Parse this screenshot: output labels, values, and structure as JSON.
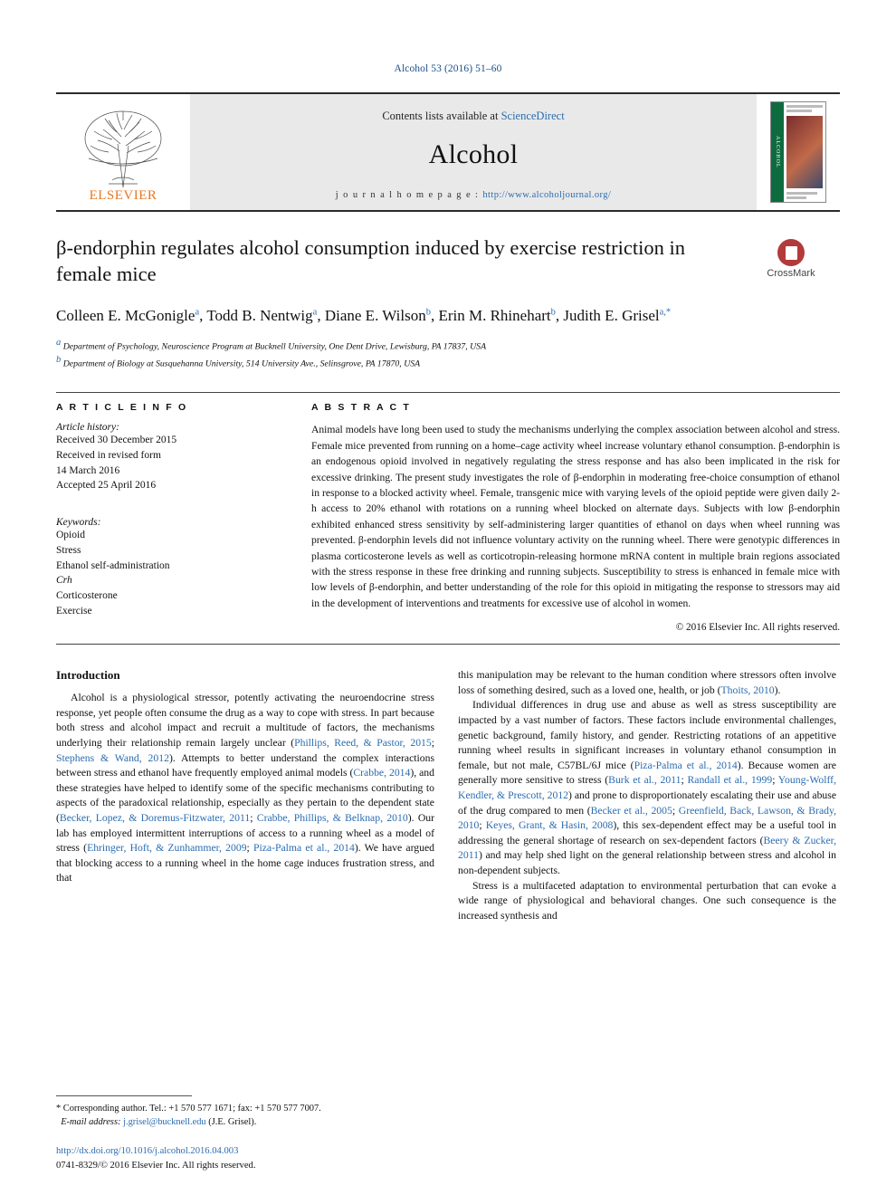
{
  "runhead": "Alcohol 53 (2016) 51–60",
  "masthead": {
    "contents_prefix": "Contents lists available at ",
    "contents_link": "ScienceDirect",
    "journal": "Alcohol",
    "homepage_label": "j o u r n a l   h o m e p a g e :   ",
    "homepage_url": "http://www.alcoholjournal.org/",
    "publisher": "ELSEVIER",
    "cover_spine": "ALCOHOL",
    "logo_icon": "elsevier-tree-logo"
  },
  "article": {
    "title": "β-endorphin regulates alcohol consumption induced by exercise restriction in female mice",
    "crossmark_label": "CrossMark",
    "authors": [
      {
        "name": "Colleen E. McGonigle",
        "sup": "a"
      },
      {
        "name": "Todd B. Nentwig",
        "sup": "a"
      },
      {
        "name": "Diane E. Wilson",
        "sup": "b"
      },
      {
        "name": "Erin M. Rhinehart",
        "sup": "b"
      },
      {
        "name": "Judith E. Grisel",
        "sup": "a,"
      }
    ],
    "affiliations": [
      {
        "sup": "a",
        "text": "Department of Psychology, Neuroscience Program at Bucknell University, One Dent Drive, Lewisburg, PA 17837, USA"
      },
      {
        "sup": "b",
        "text": "Department of Biology at Susquehanna University, 514 University Ave., Selinsgrove, PA 17870, USA"
      }
    ]
  },
  "info": {
    "heading": "A R T I C L E    I N F O",
    "history_title": "Article history:",
    "history": [
      "Received 30 December 2015",
      "Received in revised form",
      "14 March 2016",
      "Accepted 25 April 2016"
    ],
    "keywords_title": "Keywords:",
    "keywords": [
      "Opioid",
      "Stress",
      "Ethanol self-administration",
      "Crh",
      "Corticosterone",
      "Exercise"
    ],
    "keywords_italic_index": 3
  },
  "abstract": {
    "heading": "A B S T R A C T",
    "text": "Animal models have long been used to study the mechanisms underlying the complex association between alcohol and stress. Female mice prevented from running on a home–cage activity wheel increase voluntary ethanol consumption. β-endorphin is an endogenous opioid involved in negatively regulating the stress response and has also been implicated in the risk for excessive drinking. The present study investigates the role of β-endorphin in moderating free-choice consumption of ethanol in response to a blocked activity wheel. Female, transgenic mice with varying levels of the opioid peptide were given daily 2-h access to 20% ethanol with rotations on a running wheel blocked on alternate days. Subjects with low β-endorphin exhibited enhanced stress sensitivity by self-administering larger quantities of ethanol on days when wheel running was prevented. β-endorphin levels did not influence voluntary activity on the running wheel. There were genotypic differences in plasma corticosterone levels as well as corticotropin-releasing hormone mRNA content in multiple brain regions associated with the stress response in these free drinking and running subjects. Susceptibility to stress is enhanced in female mice with low levels of β-endorphin, and better understanding of the role for this opioid in mitigating the response to stressors may aid in the development of interventions and treatments for excessive use of alcohol in women.",
    "copyright": "© 2016 Elsevier Inc. All rights reserved."
  },
  "body": {
    "section_heading": "Introduction",
    "left_paragraphs": [
      "Alcohol is a physiological stressor, potently activating the neuroendocrine stress response, yet people often consume the drug as a way to cope with stress. In part because both stress and alcohol impact and recruit a multitude of factors, the mechanisms underlying their relationship remain largely unclear (Phillips, Reed, & Pastor, 2015; Stephens & Wand, 2012). Attempts to better understand the complex interactions between stress and ethanol have frequently employed animal models (Crabbe, 2014), and these strategies have helped to identify some of the specific mechanisms contributing to aspects of the paradoxical relationship, especially as they pertain to the dependent state (Becker, Lopez, & Doremus-Fitzwater, 2011; Crabbe, Phillips, & Belknap, 2010). Our lab has employed intermittent interruptions of access to a running wheel as a model of stress (Ehringer, Hoft, & Zunhammer, 2009; Piza-Palma et al., 2014). We have argued that blocking access to a running wheel in the home cage induces frustration stress, and that"
    ],
    "right_paragraphs": [
      "this manipulation may be relevant to the human condition where stressors often involve loss of something desired, such as a loved one, health, or job (Thoits, 2010).",
      "Individual differences in drug use and abuse as well as stress susceptibility are impacted by a vast number of factors. These factors include environmental challenges, genetic background, family history, and gender. Restricting rotations of an appetitive running wheel results in significant increases in voluntary ethanol consumption in female, but not male, C57BL/6J mice (Piza-Palma et al., 2014). Because women are generally more sensitive to stress (Burk et al., 2011; Randall et al., 1999; Young-Wolff, Kendler, & Prescott, 2012) and prone to disproportionately escalating their use and abuse of the drug compared to men (Becker et al., 2005; Greenfield, Back, Lawson, & Brady, 2010; Keyes, Grant, & Hasin, 2008), this sex-dependent effect may be a useful tool in addressing the general shortage of research on sex-dependent factors (Beery & Zucker, 2011) and may help shed light on the general relationship between stress and alcohol in non-dependent subjects.",
      "Stress is a multifaceted adaptation to environmental perturbation that can evoke a wide range of physiological and behavioral changes. One such consequence is the increased synthesis and"
    ]
  },
  "footnote": {
    "corresponding": "* Corresponding author. Tel.: +1 570 577 1671; fax: +1 570 577 7007.",
    "email_label": "E-mail address:",
    "email": "j.grisel@bucknell.edu",
    "email_suffix": "(J.E. Grisel)."
  },
  "footer": {
    "doi": "http://dx.doi.org/10.1016/j.alcohol.2016.04.003",
    "issn": "0741-8329/© 2016 Elsevier Inc. All rights reserved."
  },
  "colors": {
    "link": "#2b6cb0",
    "elsevier_orange": "#e87722",
    "crossmark_red": "#b33a3a",
    "cover_green": "#0d6b3f"
  }
}
